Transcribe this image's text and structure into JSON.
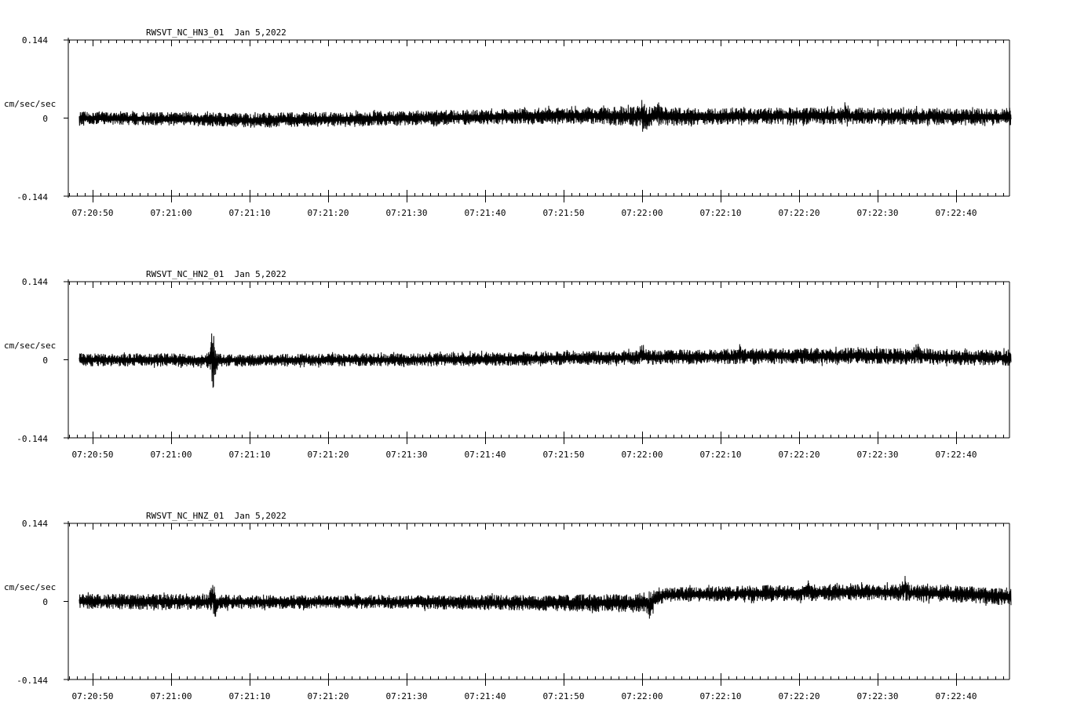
{
  "chart_data": [
    {
      "type": "line",
      "title": "RWSVT_NC_HN3_01  Jan 5,2022",
      "ylabel": "cm/sec/sec",
      "ylim": [
        -0.144,
        0.144
      ],
      "y_ticks": [
        "0.144",
        "0",
        "-0.144"
      ],
      "x_tick_labels": [
        "07:20:50",
        "07:21:00",
        "07:21:10",
        "07:21:20",
        "07:21:30",
        "07:21:40",
        "07:21:50",
        "07:22:00",
        "07:22:10",
        "07:22:20",
        "07:22:30",
        "07:22:40"
      ],
      "xlim_seconds_after_07_20_50": [
        -3,
        117
      ],
      "series": [
        {
          "trace_seconds_after_07_20_50": [
            -1.7,
            117
          ],
          "envelope_time_s": [
            -1.7,
            10,
            20,
            30,
            40,
            50,
            60,
            70,
            80,
            90,
            100,
            117
          ],
          "envelope_upper": [
            0.012,
            0.011,
            0.01,
            0.012,
            0.014,
            0.016,
            0.02,
            0.022,
            0.018,
            0.02,
            0.019,
            0.018
          ],
          "envelope_lower": [
            -0.012,
            -0.014,
            -0.018,
            -0.016,
            -0.014,
            -0.012,
            -0.01,
            -0.016,
            -0.012,
            -0.012,
            -0.012,
            -0.014
          ],
          "peaks": [
            {
              "t": 70,
              "value": 0.035
            },
            {
              "t": 70.2,
              "value": -0.03
            },
            {
              "t": 72,
              "value": 0.032
            },
            {
              "t": 96,
              "value": 0.03
            }
          ]
        }
      ]
    },
    {
      "type": "line",
      "title": "RWSVT_NC_HN2_01  Jan 5,2022",
      "ylabel": "cm/sec/sec",
      "ylim": [
        -0.144,
        0.144
      ],
      "y_ticks": [
        "0.144",
        "0",
        "-0.144"
      ],
      "x_tick_labels": [
        "07:20:50",
        "07:21:00",
        "07:21:10",
        "07:21:20",
        "07:21:30",
        "07:21:40",
        "07:21:50",
        "07:22:00",
        "07:22:10",
        "07:22:20",
        "07:22:30",
        "07:22:40"
      ],
      "xlim_seconds_after_07_20_50": [
        -3,
        117
      ],
      "series": [
        {
          "trace_seconds_after_07_20_50": [
            -1.7,
            117
          ],
          "envelope_time_s": [
            -1.7,
            10,
            20,
            30,
            40,
            50,
            60,
            70,
            80,
            90,
            100,
            117
          ],
          "envelope_upper": [
            0.012,
            0.012,
            0.01,
            0.012,
            0.012,
            0.014,
            0.016,
            0.018,
            0.02,
            0.022,
            0.022,
            0.018
          ],
          "envelope_lower": [
            -0.012,
            -0.013,
            -0.012,
            -0.012,
            -0.012,
            -0.012,
            -0.01,
            -0.01,
            -0.008,
            -0.008,
            -0.008,
            -0.012
          ],
          "peaks": [
            {
              "t": 15.3,
              "value": 0.055
            },
            {
              "t": 15.4,
              "value": -0.055
            },
            {
              "t": 70,
              "value": 0.03
            },
            {
              "t": 82.5,
              "value": 0.03
            },
            {
              "t": 105,
              "value": 0.032
            }
          ]
        }
      ]
    },
    {
      "type": "line",
      "title": "RWSVT_NC_HNZ_01  Jan 5,2022",
      "ylabel": "cm/sec/sec",
      "ylim": [
        -0.144,
        0.144
      ],
      "y_ticks": [
        "0.144",
        "0",
        "-0.144"
      ],
      "x_tick_labels": [
        "07:20:50",
        "07:21:00",
        "07:21:10",
        "07:21:20",
        "07:21:30",
        "07:21:40",
        "07:21:50",
        "07:22:00",
        "07:22:10",
        "07:22:20",
        "07:22:30",
        "07:22:40"
      ],
      "xlim_seconds_after_07_20_50": [
        -3,
        117
      ],
      "series": [
        {
          "trace_seconds_after_07_20_50": [
            -1.7,
            117
          ],
          "envelope_time_s": [
            -1.7,
            10,
            20,
            30,
            40,
            50,
            60,
            70,
            73,
            80,
            90,
            100,
            110,
            117
          ],
          "envelope_upper": [
            0.014,
            0.014,
            0.012,
            0.012,
            0.012,
            0.012,
            0.012,
            0.016,
            0.026,
            0.028,
            0.032,
            0.032,
            0.03,
            0.026
          ],
          "envelope_lower": [
            -0.014,
            -0.016,
            -0.014,
            -0.014,
            -0.014,
            -0.016,
            -0.018,
            -0.022,
            -0.002,
            0.0,
            0.0,
            0.002,
            -0.002,
            -0.008
          ],
          "peaks": [
            {
              "t": 15.3,
              "value": 0.036
            },
            {
              "t": 15.6,
              "value": -0.036
            },
            {
              "t": 71,
              "value": -0.04
            },
            {
              "t": 91,
              "value": 0.044
            },
            {
              "t": 103.5,
              "value": 0.05
            }
          ]
        }
      ]
    }
  ]
}
